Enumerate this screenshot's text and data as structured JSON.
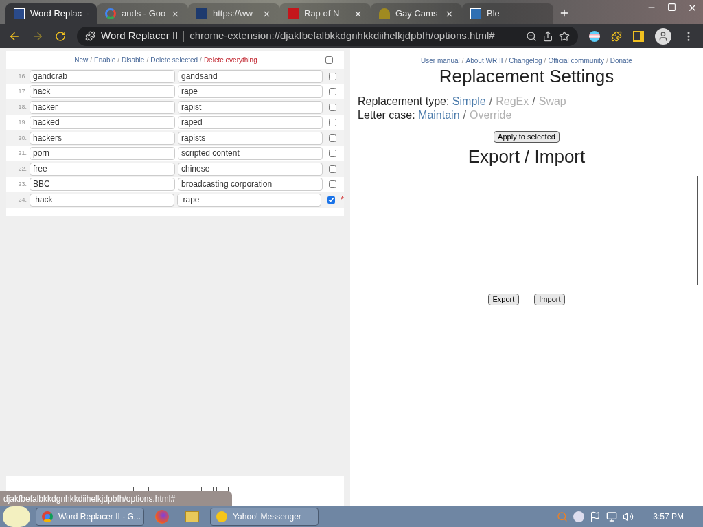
{
  "browser": {
    "tabs": [
      {
        "title": "Word Replac",
        "selected": true
      },
      {
        "title": "ands - Goo",
        "selected": false
      },
      {
        "title": "https://ww",
        "selected": false
      },
      {
        "title": "Rap of N",
        "selected": false
      },
      {
        "title": "Gay Cams",
        "selected": false
      },
      {
        "title": "Ble",
        "selected": false
      }
    ],
    "site_name": "Word Replacer II",
    "url": "chrome-extension://djakfbefalbkkdgnhkkdiihelkjdpbfh/options.html#"
  },
  "list_panel": {
    "actions": [
      {
        "label": "New",
        "kind": "normal"
      },
      {
        "label": "/",
        "kind": "separator"
      },
      {
        "label": "Enable",
        "kind": "normal"
      },
      {
        "label": "/",
        "kind": "separator"
      },
      {
        "label": "Disable",
        "kind": "normal"
      },
      {
        "label": "/",
        "kind": "separator"
      },
      {
        "label": "Delete selected",
        "kind": "normal"
      },
      {
        "label": "/",
        "kind": "separator"
      },
      {
        "label": "Delete everything",
        "kind": "danger"
      }
    ],
    "select_all": {
      "checked": false
    },
    "rows": [
      {
        "number": "16.",
        "find": "gandcrab",
        "replace": "gandsand",
        "checked": false,
        "modified": false
      },
      {
        "number": "17.",
        "find": "hack",
        "replace": "rape",
        "checked": false,
        "modified": false
      },
      {
        "number": "18.",
        "find": "hacker",
        "replace": "rapist",
        "checked": false,
        "modified": false
      },
      {
        "number": "19.",
        "find": "hacked",
        "replace": "raped",
        "checked": false,
        "modified": false
      },
      {
        "number": "20.",
        "find": "hackers",
        "replace": "rapists",
        "checked": false,
        "modified": false
      },
      {
        "number": "21.",
        "find": "porn",
        "replace": "scripted content",
        "checked": false,
        "modified": false
      },
      {
        "number": "22.",
        "find": "free",
        "replace": "chinese",
        "checked": false,
        "modified": false
      },
      {
        "number": "23.",
        "find": "BBC",
        "replace": "broadcasting corporation",
        "checked": false,
        "modified": false
      },
      {
        "number": "24.",
        "find": " hack",
        "replace": " rape",
        "checked": true,
        "modified": true,
        "marker": "*"
      }
    ]
  },
  "settings": {
    "links": [
      {
        "label": "User manual",
        "kind": "link"
      },
      {
        "label": "/",
        "kind": "separator"
      },
      {
        "label": "About WR II",
        "kind": "link"
      },
      {
        "label": "/",
        "kind": "separator"
      },
      {
        "label": "Changelog",
        "kind": "link"
      },
      {
        "label": "/",
        "kind": "separator"
      },
      {
        "label": "Official community",
        "kind": "link"
      },
      {
        "label": "/",
        "kind": "separator"
      },
      {
        "label": "Donate",
        "kind": "link"
      }
    ],
    "title": "Replacement Settings",
    "options": [
      {
        "label": "Replacement type:",
        "choices": [
          {
            "label": "Simple",
            "selected": true
          },
          {
            "label": "RegEx",
            "selected": false
          },
          {
            "label": "Swap",
            "selected": false
          }
        ],
        "separators": [
          "/",
          "/"
        ]
      },
      {
        "label": "Letter case:",
        "choices": [
          {
            "label": "Maintain",
            "selected": true
          },
          {
            "label": "Override",
            "selected": false
          }
        ],
        "separators": [
          "/"
        ]
      }
    ],
    "apply_button": "Apply to selected",
    "export_title": "Export / Import",
    "buttons": [
      "Export",
      "Import"
    ]
  },
  "status_bubble": "djakfbefalbkkdgnhkkdiihelkjdpbfh/options.html#",
  "taskbar": {
    "items": [
      {
        "kind": "window",
        "label": "Word Replacer II - G..."
      },
      {
        "kind": "icon"
      },
      {
        "kind": "icon"
      },
      {
        "kind": "window",
        "label": "Yahoo! Messenger"
      }
    ],
    "clock": "3:57 PM"
  }
}
